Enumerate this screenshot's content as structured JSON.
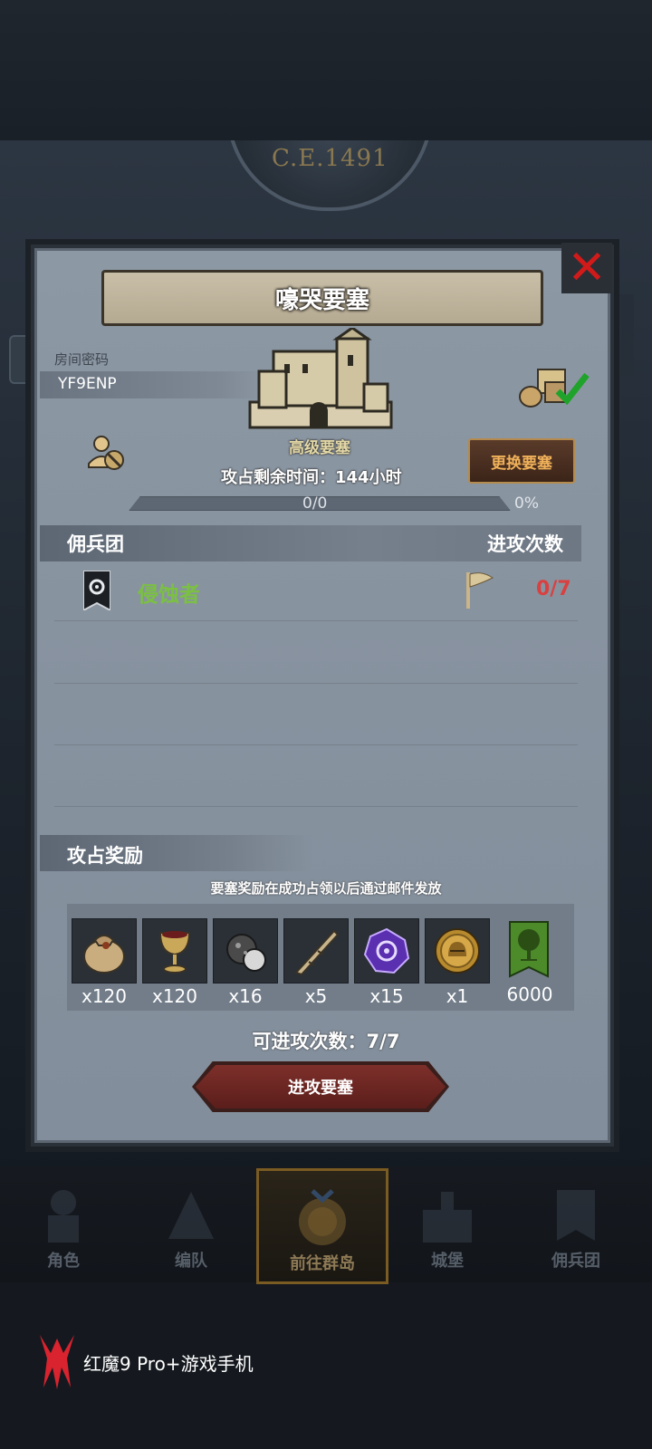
{
  "background": {
    "era": "C.E.1491"
  },
  "modal": {
    "title": "嚎哭要塞",
    "room": {
      "label": "房间密码",
      "code": "YF9ENP"
    },
    "fortress": {
      "tier": "高级要塞",
      "change_button": "更换要塞",
      "timer": "攻占剩余时间：144小时",
      "progress_count": "0/0",
      "progress_percent": "0%",
      "progress_fraction": 0
    },
    "mercenary_section": {
      "title": "佣兵团",
      "attacks_title": "进攻次数",
      "rows": [
        {
          "name": "侵蚀者",
          "attacks": "0/7"
        }
      ]
    },
    "reward_section": {
      "title": "攻占奖励",
      "note": "要塞奖励在成功占领以后通过邮件发放",
      "items": [
        {
          "icon": "sack-icon",
          "qty": "x120"
        },
        {
          "icon": "goblet-icon",
          "qty": "x120"
        },
        {
          "icon": "ore-icon",
          "qty": "x16"
        },
        {
          "icon": "horn-icon",
          "qty": "x5"
        },
        {
          "icon": "purple-gem-icon",
          "qty": "x15"
        },
        {
          "icon": "helmet-coin-icon",
          "qty": "x1"
        },
        {
          "icon": "tree-banner-icon",
          "qty": "6000"
        }
      ]
    },
    "remaining_attacks": "可进攻次数：7/7",
    "attack_button": "进攻要塞"
  },
  "bottom_nav": {
    "items": [
      {
        "label": "角色"
      },
      {
        "label": "编队"
      },
      {
        "label": "前往群岛",
        "active": true
      },
      {
        "label": "城堡"
      },
      {
        "label": "佣兵团"
      }
    ]
  },
  "watermark": {
    "text": "红魔9 Pro+游戏手机"
  },
  "colors": {
    "merc_name": "#7bc043",
    "attack_count": "#d94040",
    "change_button_text": "#f0b15a",
    "close_x": "#d11a1a"
  }
}
